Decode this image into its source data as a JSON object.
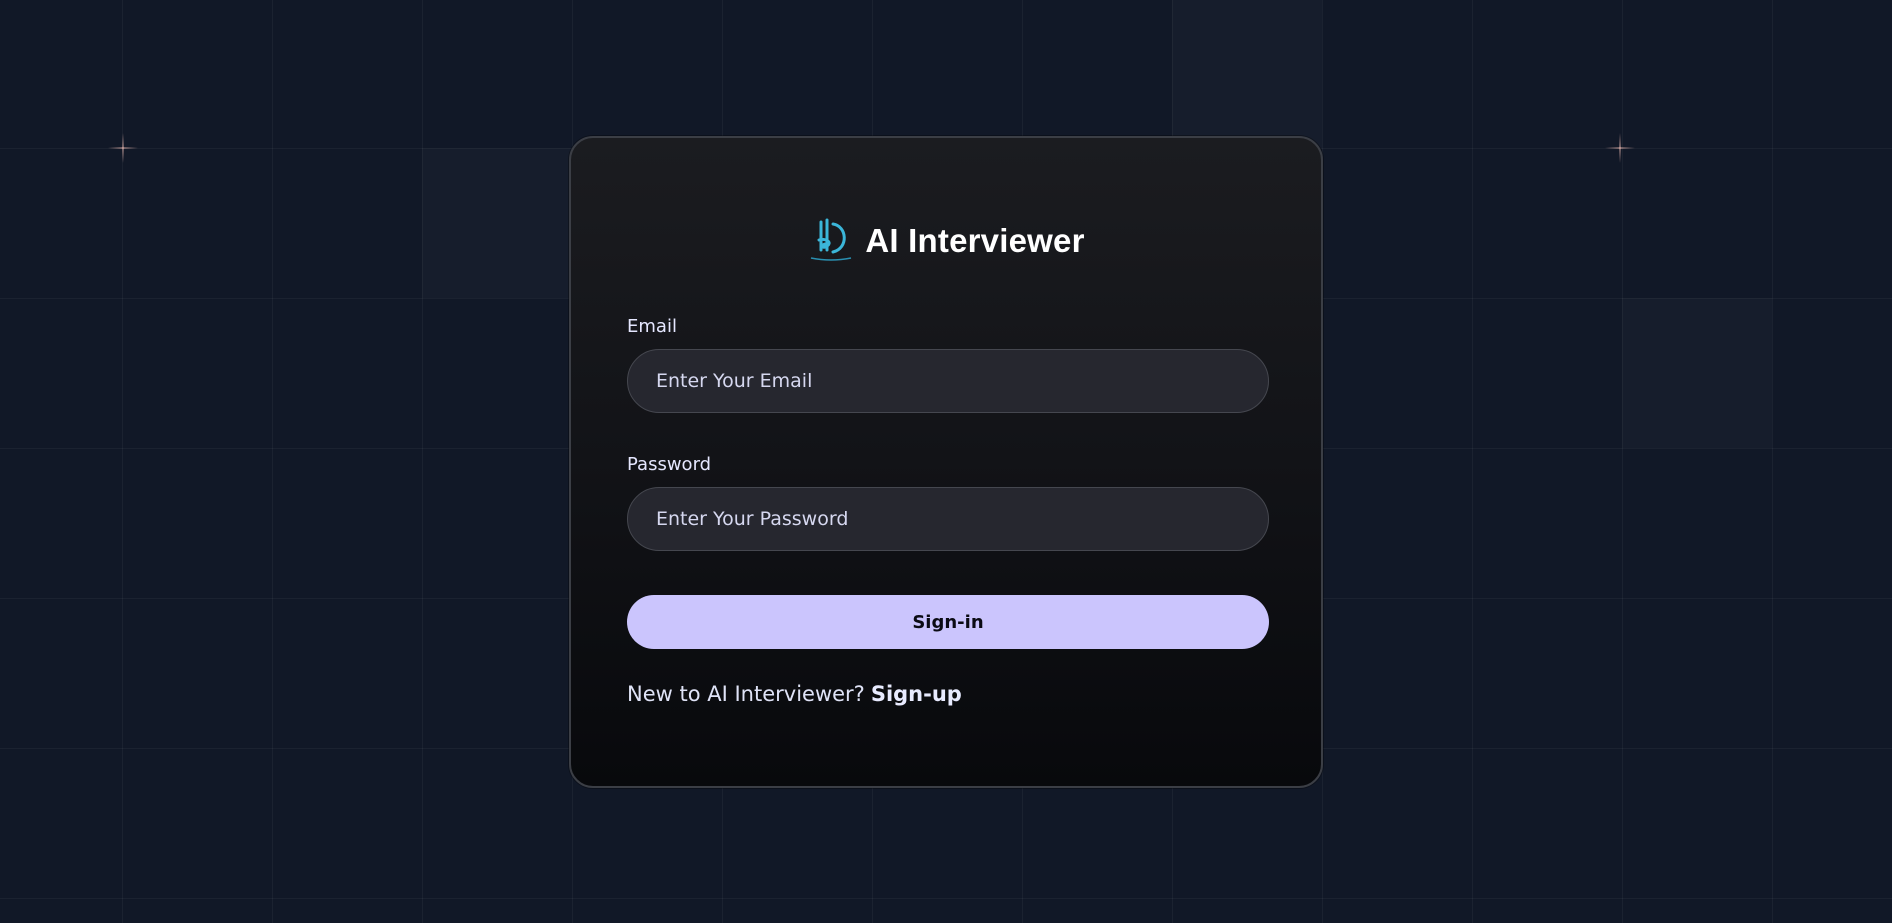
{
  "brand": {
    "title": "AI Interviewer",
    "logo_icon": "ai-interviewer-logo-icon",
    "logo_color": "#3bb6d9"
  },
  "form": {
    "email": {
      "label": "Email",
      "placeholder": "Enter Your Email",
      "value": ""
    },
    "password": {
      "label": "Password",
      "placeholder": "Enter Your Password",
      "value": ""
    },
    "submit_label": "Sign-in"
  },
  "footer": {
    "prompt": "New to AI Interviewer?",
    "link_label": "Sign-up"
  },
  "colors": {
    "background": "#111827",
    "card": "#16171b",
    "button": "#cbc5fd",
    "input": "#26272f"
  }
}
